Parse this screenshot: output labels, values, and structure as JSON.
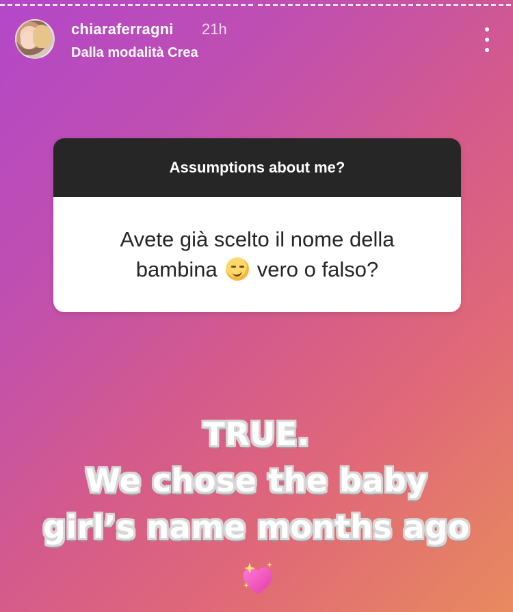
{
  "story": {
    "segments": 2,
    "colors": {
      "gradient": [
        "#b347c9",
        "#c04fb0",
        "#d45a8c",
        "#e06878",
        "#e88a5e"
      ],
      "question_header_bg": "#262626",
      "question_body_bg": "#ffffff"
    }
  },
  "header": {
    "username": "chiaraferragni",
    "time": "21h",
    "subtitle": "Dalla modalità Crea",
    "more_icon": "more-vertical-icon"
  },
  "question_sticker": {
    "prompt": "Assumptions about me?",
    "line1": "Avete già scelto il nome della",
    "line2_before_emoji": "bambina",
    "emoji": "smirking-face",
    "line2_after_emoji": "vero o falso?"
  },
  "answer": {
    "line1": "TRUE.",
    "line2": "We chose the baby",
    "line3": "girl’s name months ago",
    "emoji": "sparkling-heart"
  }
}
